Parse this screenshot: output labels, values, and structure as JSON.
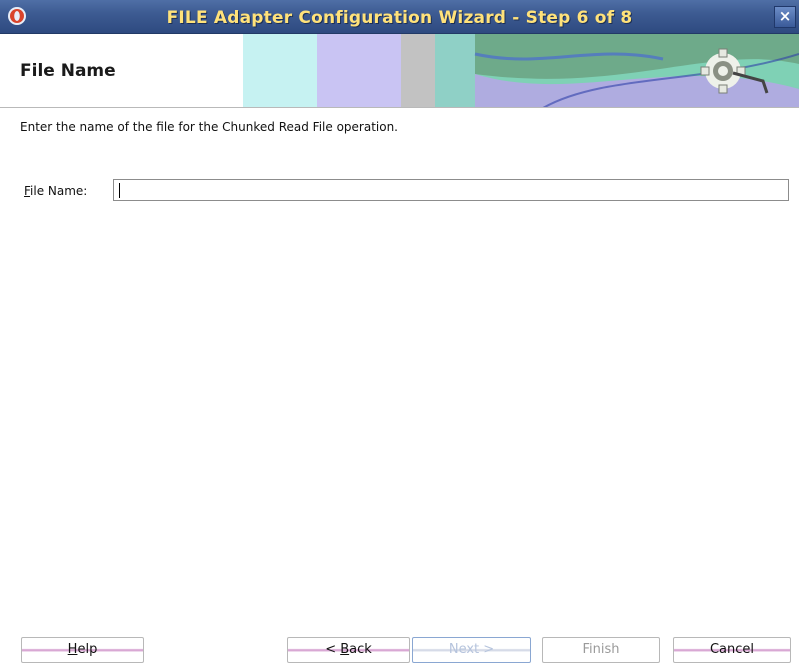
{
  "window": {
    "title": "FILE Adapter Configuration Wizard - Step 6 of 8",
    "close_glyph": "×"
  },
  "header": {
    "title": "File Name"
  },
  "main": {
    "instruction": "Enter the name of the file for the Chunked Read File operation.",
    "file_name_label_mnemonic": "F",
    "file_name_label_rest": "ile Name:",
    "file_name_value": ""
  },
  "footer": {
    "help": {
      "mnemonic": "H",
      "rest": "elp"
    },
    "back": {
      "prefix": "< ",
      "mnemonic": "B",
      "rest": "ack"
    },
    "next": {
      "label": "Next >"
    },
    "finish": {
      "label": "Finish"
    },
    "cancel": {
      "label": "Cancel"
    }
  },
  "colors": {
    "titlebar_text": "#ffe27a",
    "titlebar_bg": "#3d5b92"
  },
  "icons": [
    "app-logo-icon",
    "close-icon",
    "adapter-gear-icon"
  ]
}
